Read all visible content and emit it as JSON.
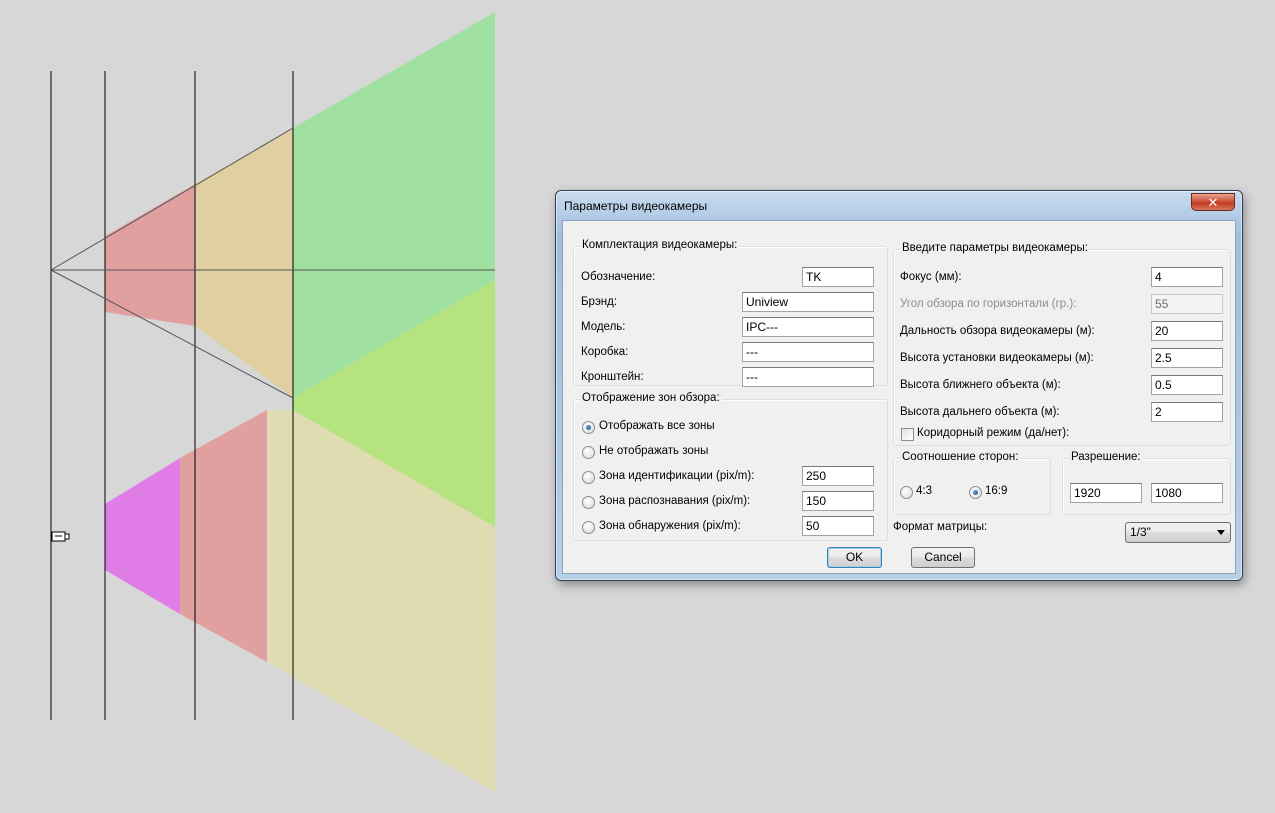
{
  "colors": {
    "background": "#d7d7d7",
    "zone_green": "#a0e0a0",
    "zone_tan": "#e0cfa0",
    "zone_red": "#e0a0a0",
    "zone_lime": "#b5e380",
    "zone_yellow": "#dedcb0",
    "zone_magenta": "#e07ce6"
  },
  "dialog": {
    "title": "Параметры видеокамеры",
    "close_glyph": "✕",
    "kit": {
      "legend": "Комплектация видеокамеры:",
      "designation_label": "Обозначение:",
      "designation_value": "TK",
      "brand_label": "Брэнд:",
      "brand_value": "Uniview",
      "model_label": "Модель:",
      "model_value": "IPC---",
      "box_label": "Коробка:",
      "box_value": "---",
      "bracket_label": "Кронштейн:",
      "bracket_value": "---"
    },
    "zones": {
      "legend": "Отображение зон обзора:",
      "show_all_label": "Отображать все зоны",
      "hide_label": "Не отображать зоны",
      "identification_label": "Зона идентификации (pix/m):",
      "identification_value": "250",
      "recognition_label": "Зона распознавания (pix/m):",
      "recognition_value": "150",
      "detection_label": "Зона обнаружения (pix/m):",
      "detection_value": "50"
    },
    "params": {
      "legend": "Введите параметры видеокамеры:",
      "focus_label": "Фокус (мм):",
      "focus_value": "4",
      "hangle_label": "Угол обзора по горизонтали (гр.):",
      "hangle_value": "55",
      "range_label": "Дальность обзора видеокамеры (м):",
      "range_value": "20",
      "mount_height_label": "Высота установки видеокамеры (м):",
      "mount_height_value": "2.5",
      "near_height_label": "Высота ближнего объекта (м):",
      "near_height_value": "0.5",
      "far_height_label": "Высота дальнего объекта (м):",
      "far_height_value": "2",
      "corridor_label": "Коридорный режим (да/нет):"
    },
    "aspect": {
      "legend": "Соотношение сторон:",
      "opt_4_3": "4:3",
      "opt_16_9": "16:9"
    },
    "resolution": {
      "legend": "Разрешение:",
      "width": "1920",
      "height": "1080"
    },
    "matrix": {
      "label": "Формат матрицы:",
      "value": "1/3\""
    },
    "ok_label": "OK",
    "cancel_label": "Cancel"
  }
}
